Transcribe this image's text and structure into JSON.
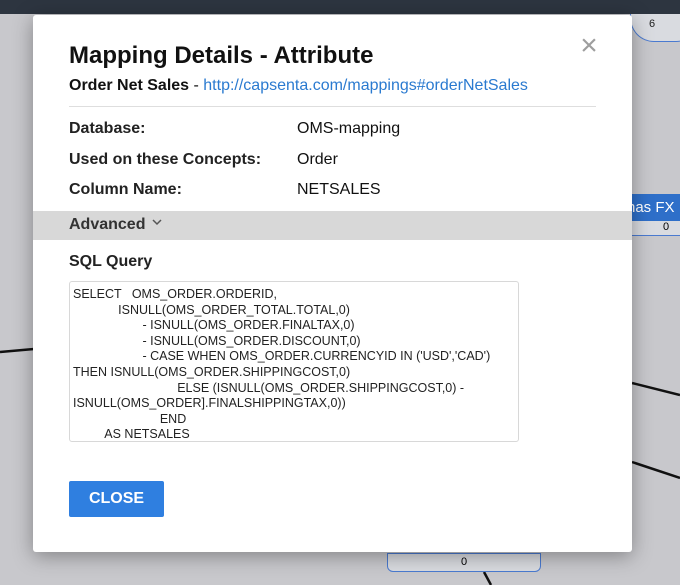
{
  "background": {
    "node_top_value": "6",
    "node_right_label": "nas FX",
    "node_right_value": "0",
    "node_bottom_value": "0"
  },
  "modal": {
    "title": "Mapping Details - Attribute",
    "subtitle_name": "Order Net Sales",
    "subtitle_sep": " - ",
    "subtitle_link": "http://capsenta.com/mappings#orderNetSales",
    "close_icon": "×",
    "fields": [
      {
        "label": "Database:",
        "value": "OMS-mapping"
      },
      {
        "label": "Used on these Concepts:",
        "value": "Order"
      },
      {
        "label": "Column Name:",
        "value": "NETSALES"
      }
    ],
    "advanced_label": "Advanced",
    "advanced_icon": "chevron-down",
    "sql_label": "SQL Query",
    "sql_query": "SELECT   OMS_ORDER.ORDERID,\n             ISNULL(OMS_ORDER_TOTAL.TOTAL,0)\n                    - ISNULL(OMS_ORDER.FINALTAX,0)\n                    - ISNULL(OMS_ORDER.DISCOUNT,0)\n                    - CASE WHEN OMS_ORDER.CURRENCYID IN ('USD','CAD') THEN ISNULL(OMS_ORDER.SHIPPINGCOST,0)\n                              ELSE (ISNULL(OMS_ORDER.SHIPPINGCOST,0) - ISNULL(OMS_ORDER].FINALSHIPPINGTAX,0))\n                         END\n         AS NETSALES",
    "close_button": "CLOSE"
  },
  "colors": {
    "accent": "#2f7fe0",
    "link": "#2a7ad0",
    "node_header": "#2e6fc9"
  }
}
